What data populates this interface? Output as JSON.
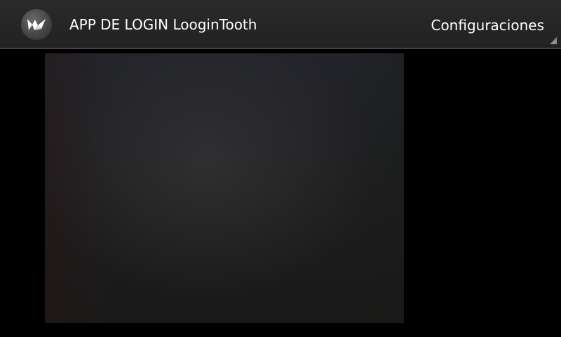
{
  "action_bar": {
    "icon": "kivy-logo-icon",
    "title": "APP DE LOGIN LooginTooth",
    "settings_label": "Configuraciones",
    "overflow_icon": "overflow-triangle-icon"
  },
  "colors": {
    "action_bar_bg": "#262626",
    "background": "#000000",
    "text": "#ffffff"
  }
}
